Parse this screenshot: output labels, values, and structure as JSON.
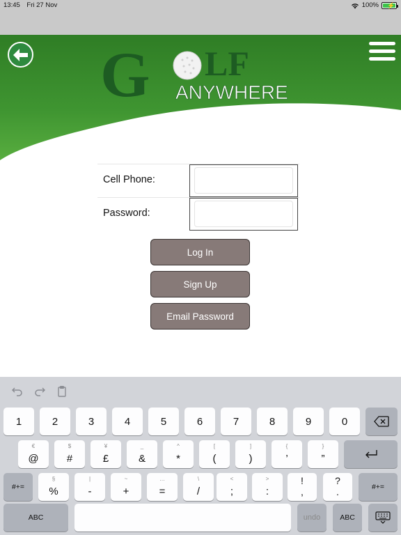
{
  "status_bar": {
    "time": "13:45",
    "date": "Fri 27 Nov",
    "battery": "100%"
  },
  "logo": {
    "line1_left": "G",
    "line1_right": "LF",
    "line2": "ANYWHERE"
  },
  "icons": {
    "back": "arrow-left-icon",
    "menu": "hamburger-menu-icon"
  },
  "form": {
    "phone_label": "Cell Phone:",
    "phone_value": "",
    "password_label": "Password:",
    "password_value": ""
  },
  "buttons": {
    "login": "Log In",
    "signup": "Sign Up",
    "email_password": "Email Password"
  },
  "keyboard": {
    "row1": [
      "1",
      "2",
      "3",
      "4",
      "5",
      "6",
      "7",
      "8",
      "9",
      "0"
    ],
    "row2": [
      {
        "sub": "€",
        "main": "@"
      },
      {
        "sub": "$",
        "main": "#"
      },
      {
        "sub": "¥",
        "main": "£"
      },
      {
        "sub": "_",
        "main": "&"
      },
      {
        "sub": "^",
        "main": "*"
      },
      {
        "sub": "[",
        "main": "("
      },
      {
        "sub": "]",
        "main": ")"
      },
      {
        "sub": "{",
        "main": "’"
      },
      {
        "sub": "}",
        "main": "”"
      }
    ],
    "row3": [
      {
        "sub": "§",
        "main": "%"
      },
      {
        "sub": "|",
        "main": "-"
      },
      {
        "sub": "~",
        "main": "+"
      },
      {
        "sub": "…",
        "main": "="
      },
      {
        "sub": "\\",
        "main": "/"
      },
      {
        "sub": "<",
        "main": ";"
      },
      {
        "sub": ">",
        "main": ":"
      },
      {
        "sub": "!",
        "main": "!"
      },
      {
        "sub": "?",
        "main": "?"
      }
    ],
    "shift_label": "#+=",
    "abc_label": "ABC",
    "undo_label": "undo"
  },
  "colors": {
    "header_green": "#3a8a2c",
    "button_bg": "#877a78",
    "logo_green": "#1d5c22"
  }
}
